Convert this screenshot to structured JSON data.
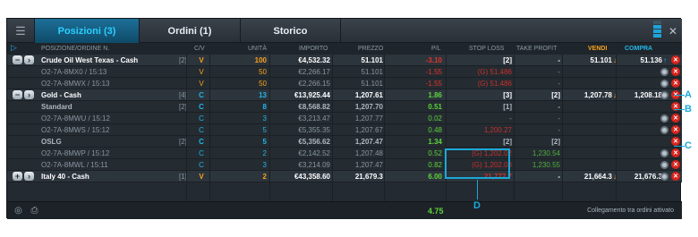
{
  "tabs": [
    {
      "label": "Posizioni (3)",
      "active": true
    },
    {
      "label": "Ordini (1)",
      "active": false
    },
    {
      "label": "Storico",
      "active": false
    }
  ],
  "columns": {
    "name": "POSIZIONE/ORDINE N.",
    "cv": "C/V",
    "units": "UNITÀ",
    "amount": "IMPORTO",
    "price": "PREZZO",
    "pl": "P/L",
    "stop_loss": "STOP LOSS",
    "take_profit": "TAKE PROFIT",
    "sell": "VENDI",
    "buy": "COMPRA"
  },
  "rows": [
    {
      "type": "main",
      "name": "Crude Oil West Texas - Cash",
      "count": "[2]",
      "cv": "V",
      "units": "100",
      "amount": "€4,532.32",
      "price": "51.101",
      "pl": "-3.10",
      "sl": "[2]",
      "tp": "-",
      "sell": "51.101",
      "buy": "51.136"
    },
    {
      "type": "sub",
      "name": "O2-7A-8MX0 / 15:13",
      "count": "",
      "cv": "V",
      "units": "50",
      "amount": "€2,266.17",
      "price": "51.101",
      "pl": "-1.55",
      "sl": "(G) 51.486",
      "tp": "-",
      "sell": "",
      "buy": ""
    },
    {
      "type": "sub",
      "name": "O2-7A-8MWX / 15:13",
      "count": "",
      "cv": "V",
      "units": "50",
      "amount": "€2,266.15",
      "price": "51.101",
      "pl": "-1.55",
      "sl": "(G) 51.486",
      "tp": "-",
      "sell": "",
      "buy": ""
    },
    {
      "type": "main",
      "name": "Gold - Cash",
      "count": "[4]",
      "cv": "C",
      "units": "13",
      "amount": "€13,925.44",
      "price": "1,207.61",
      "pl": "1.86",
      "sl": "[3]",
      "tp": "[2]",
      "sell": "1,207.78",
      "buy": "1,208.18"
    },
    {
      "type": "sub2",
      "name": "Standard",
      "count": "[2]",
      "cv": "C",
      "units": "8",
      "amount": "€8,568.82",
      "price": "1,207.70",
      "pl": "0.51",
      "sl": "[1]",
      "tp": "-",
      "sell": "",
      "buy": ""
    },
    {
      "type": "sub",
      "name": "O2-7A-8MWU / 15:12",
      "count": "",
      "cv": "C",
      "units": "3",
      "amount": "€3,213.47",
      "price": "1,207.77",
      "pl": "0.02",
      "sl": "-",
      "tp": "-",
      "sell": "",
      "buy": ""
    },
    {
      "type": "sub",
      "name": "O2-7A-8MWS / 15:12",
      "count": "",
      "cv": "C",
      "units": "5",
      "amount": "€5,355.35",
      "price": "1,207.67",
      "pl": "0.48",
      "sl": "1,200.27",
      "tp": "-",
      "sell": "",
      "buy": ""
    },
    {
      "type": "sub2",
      "name": "OSLG",
      "count": "[2]",
      "cv": "C",
      "units": "5",
      "amount": "€5,356.62",
      "price": "1,207.47",
      "pl": "1.34",
      "sl": "[2]",
      "tp": "[2]",
      "sell": "",
      "buy": ""
    },
    {
      "type": "sub",
      "name": "O2-7A-8MWP / 15:12",
      "count": "",
      "cv": "C",
      "units": "2",
      "amount": "€2,142.52",
      "price": "1,207.48",
      "pl": "0.52",
      "sl": "(G) 1,202.02",
      "tp": "1,230.54",
      "sell": "",
      "buy": ""
    },
    {
      "type": "sub",
      "name": "O2-7A-8MWL / 15:11",
      "count": "",
      "cv": "C",
      "units": "3",
      "amount": "€3,214.09",
      "price": "1,207.47",
      "pl": "0.82",
      "sl": "(G) 1,202.03",
      "tp": "1,230.55",
      "sell": "",
      "buy": ""
    },
    {
      "type": "main",
      "name": "Italy 40 - Cash",
      "count": "[1]",
      "cv": "V",
      "units": "2",
      "amount": "€43,358.60",
      "price": "21,679.3",
      "pl": "6.00",
      "sl": "21,777.7",
      "tp": "-",
      "sell": "21,664.3",
      "buy": "21,676.3"
    }
  ],
  "footer": {
    "total_pl": "4.75",
    "status": "Collegamento tra ordini attivato"
  },
  "annotations": {
    "a": "A",
    "b": "B",
    "c": "C",
    "d": "D"
  },
  "colors": {
    "accent": "#23b7e8",
    "sell": "#f7a21c",
    "positive": "#5ed43a",
    "negative": "#e2342b"
  }
}
